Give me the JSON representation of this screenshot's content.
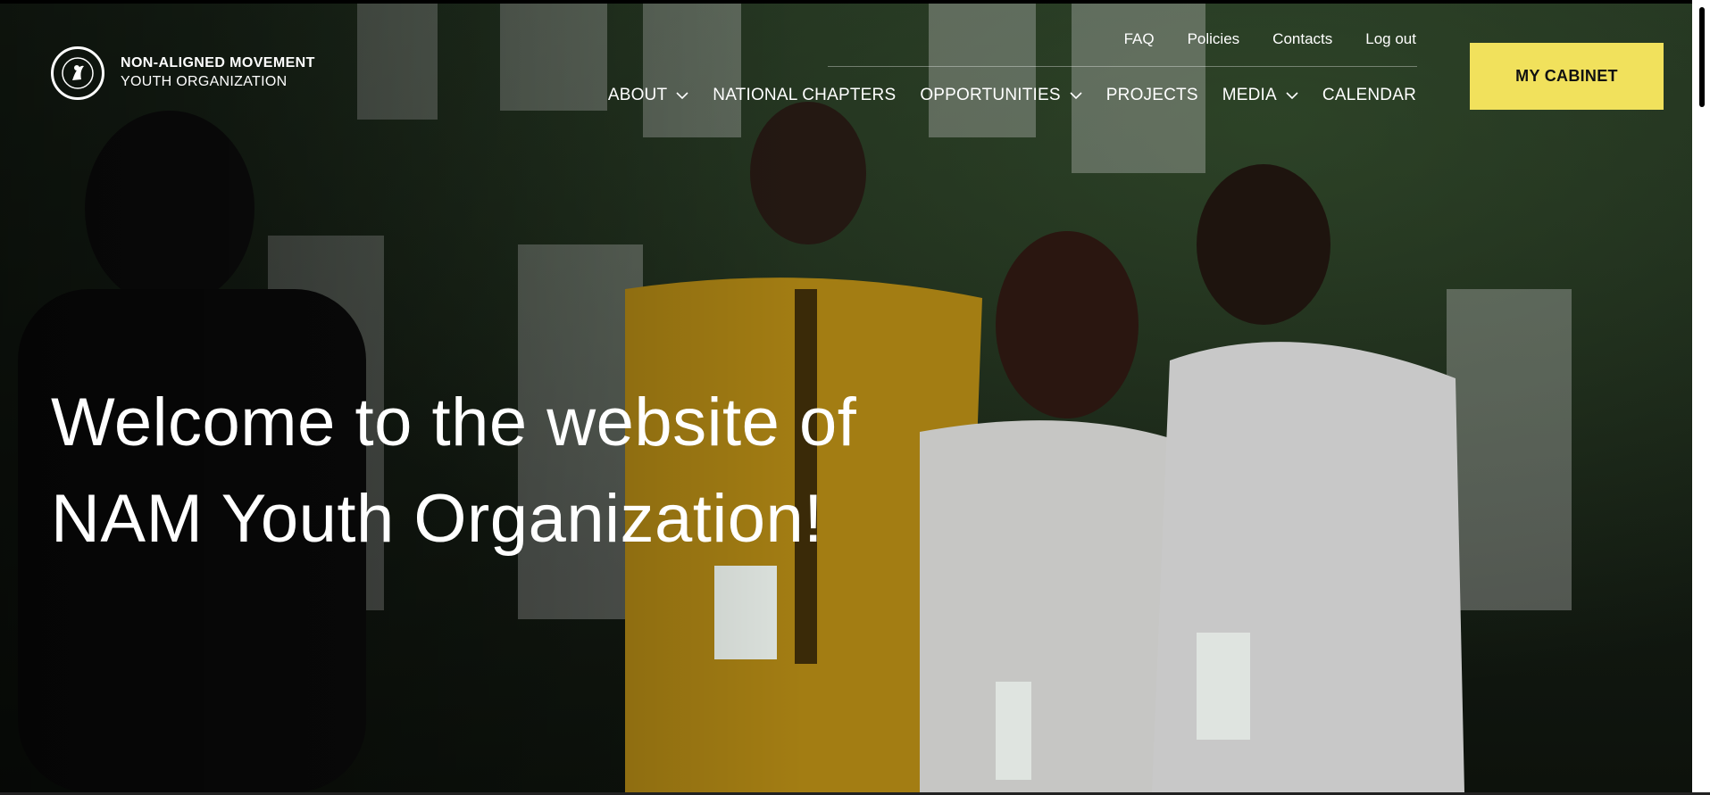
{
  "logo": {
    "line1": "NON-ALIGNED MOVEMENT",
    "line2": "YOUTH ORGANIZATION",
    "icon": "nam-emblem-icon"
  },
  "top_links": [
    "FAQ",
    "Policies",
    "Contacts",
    "Log out"
  ],
  "main_nav": [
    {
      "label": "ABOUT",
      "dropdown": true
    },
    {
      "label": "NATIONAL CHAPTERS",
      "dropdown": false
    },
    {
      "label": "OPPORTUNITIES",
      "dropdown": true
    },
    {
      "label": "PROJECTS",
      "dropdown": false
    },
    {
      "label": "MEDIA",
      "dropdown": true
    },
    {
      "label": "CALENDAR",
      "dropdown": false
    }
  ],
  "cabinet_button": "MY CABINET",
  "hero": {
    "line1": "Welcome to the website of",
    "line2": "NAM Youth Organization!"
  },
  "colors": {
    "accent": "#f1e15c",
    "text": "#ffffff"
  }
}
